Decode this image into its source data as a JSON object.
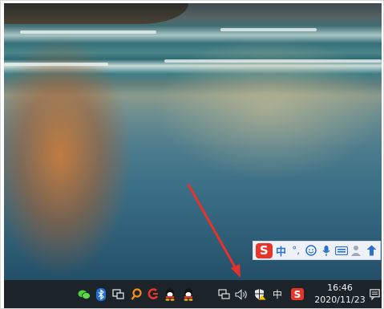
{
  "ime_toolbar": {
    "logo_text": "S",
    "mode_text": "中",
    "punctuation_text": "°,",
    "icons": [
      "emoji-icon",
      "microphone-icon",
      "keyboard-icon",
      "skin-icon",
      "toolbox-icon"
    ]
  },
  "taskbar": {
    "tray_icons": [
      "wechat-icon",
      "bluetooth-icon",
      "device-icon",
      "search-tool-icon",
      "weibo-icon",
      "qq-icon",
      "qq-icon"
    ],
    "language_indicator": "中",
    "clock": {
      "time": "16:46",
      "date": "2020/11/23"
    }
  },
  "colors": {
    "taskbar": "#1c2329",
    "arrow": "#e8312a",
    "ime_accent": "#2a6fd1",
    "sogou_red": "#e8352a"
  }
}
